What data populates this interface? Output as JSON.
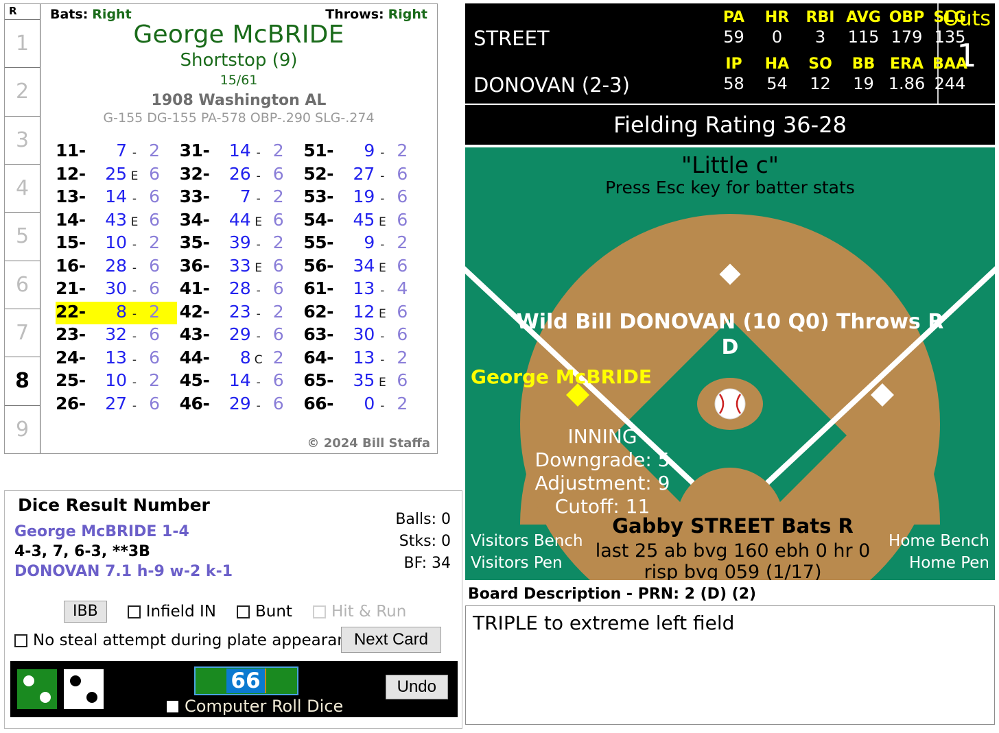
{
  "card": {
    "inning_header": "R",
    "innings": [
      "1",
      "2",
      "3",
      "4",
      "5",
      "6",
      "7",
      "8",
      "9"
    ],
    "current_inning": "8",
    "bats_label": "Bats:",
    "bats_value": "Right",
    "throws_label": "Throws:",
    "throws_value": "Right",
    "player_name": "George McBRIDE",
    "position": "Shortstop (9)",
    "ratings": "15/61",
    "team": "1908 Washington AL",
    "stats_line": "G-155 DG-155 PA-578 OBP-.290 SLG-.274",
    "copyright": "© 2024 Bill Staffa",
    "columns": [
      [
        {
          "roll": "11-",
          "num": "7",
          "flag": "-",
          "fld": "2",
          "highlight": false
        },
        {
          "roll": "12-",
          "num": "25",
          "flag": "E",
          "fld": "6",
          "highlight": false
        },
        {
          "roll": "13-",
          "num": "14",
          "flag": "-",
          "fld": "6",
          "highlight": false
        },
        {
          "roll": "14-",
          "num": "43",
          "flag": "E",
          "fld": "6",
          "highlight": false
        },
        {
          "roll": "15-",
          "num": "10",
          "flag": "-",
          "fld": "2",
          "highlight": false
        },
        {
          "roll": "16-",
          "num": "28",
          "flag": "-",
          "fld": "6",
          "highlight": false
        },
        {
          "roll": "21-",
          "num": "30",
          "flag": "-",
          "fld": "6",
          "highlight": false
        },
        {
          "roll": "22-",
          "num": "8",
          "flag": "-",
          "fld": "2",
          "highlight": true
        },
        {
          "roll": "23-",
          "num": "32",
          "flag": "-",
          "fld": "6",
          "highlight": false
        },
        {
          "roll": "24-",
          "num": "13",
          "flag": "-",
          "fld": "6",
          "highlight": false
        },
        {
          "roll": "25-",
          "num": "10",
          "flag": "-",
          "fld": "2",
          "highlight": false
        },
        {
          "roll": "26-",
          "num": "27",
          "flag": "-",
          "fld": "6",
          "highlight": false
        }
      ],
      [
        {
          "roll": "31-",
          "num": "14",
          "flag": "-",
          "fld": "2",
          "highlight": false
        },
        {
          "roll": "32-",
          "num": "26",
          "flag": "-",
          "fld": "6",
          "highlight": false
        },
        {
          "roll": "33-",
          "num": "7",
          "flag": "-",
          "fld": "2",
          "highlight": false
        },
        {
          "roll": "34-",
          "num": "44",
          "flag": "E",
          "fld": "6",
          "highlight": false
        },
        {
          "roll": "35-",
          "num": "39",
          "flag": "-",
          "fld": "2",
          "highlight": false
        },
        {
          "roll": "36-",
          "num": "33",
          "flag": "E",
          "fld": "6",
          "highlight": false
        },
        {
          "roll": "41-",
          "num": "28",
          "flag": "-",
          "fld": "6",
          "highlight": false
        },
        {
          "roll": "42-",
          "num": "23",
          "flag": "-",
          "fld": "2",
          "highlight": false
        },
        {
          "roll": "43-",
          "num": "29",
          "flag": "-",
          "fld": "6",
          "highlight": false
        },
        {
          "roll": "44-",
          "num": "8",
          "flag": "C",
          "fld": "2",
          "highlight": false
        },
        {
          "roll": "45-",
          "num": "14",
          "flag": "-",
          "fld": "6",
          "highlight": false
        },
        {
          "roll": "46-",
          "num": "29",
          "flag": "-",
          "fld": "6",
          "highlight": false
        }
      ],
      [
        {
          "roll": "51-",
          "num": "9",
          "flag": "-",
          "fld": "2",
          "highlight": false
        },
        {
          "roll": "52-",
          "num": "27",
          "flag": "-",
          "fld": "6",
          "highlight": false
        },
        {
          "roll": "53-",
          "num": "19",
          "flag": "-",
          "fld": "6",
          "highlight": false
        },
        {
          "roll": "54-",
          "num": "45",
          "flag": "E",
          "fld": "6",
          "highlight": false
        },
        {
          "roll": "55-",
          "num": "9",
          "flag": "-",
          "fld": "2",
          "highlight": false
        },
        {
          "roll": "56-",
          "num": "34",
          "flag": "E",
          "fld": "6",
          "highlight": false
        },
        {
          "roll": "61-",
          "num": "13",
          "flag": "-",
          "fld": "4",
          "highlight": false
        },
        {
          "roll": "62-",
          "num": "12",
          "flag": "E",
          "fld": "6",
          "highlight": false
        },
        {
          "roll": "63-",
          "num": "30",
          "flag": "-",
          "fld": "6",
          "highlight": false
        },
        {
          "roll": "64-",
          "num": "13",
          "flag": "-",
          "fld": "2",
          "highlight": false
        },
        {
          "roll": "65-",
          "num": "35",
          "flag": "E",
          "fld": "6",
          "highlight": false
        },
        {
          "roll": "66-",
          "num": "0",
          "flag": "-",
          "fld": "2",
          "highlight": false
        }
      ]
    ]
  },
  "dice_panel": {
    "title": "Dice Result Number",
    "batter_line": "George McBRIDE  1-4",
    "results_line": "4-3, 7, 6-3, **3B",
    "pitcher_line": "DONOVAN  7.1  h-9  w-2  k-1",
    "balls": "Balls: 0",
    "strikes": "Stks: 0",
    "bf": "BF: 34",
    "ibb_label": "IBB",
    "infield_in_label": "Infield IN",
    "bunt_label": "Bunt",
    "hit_and_run_label": "Hit & Run",
    "no_steal_label": "No steal attempt during plate appearance",
    "next_card_label": "Next Card",
    "computer_roll_label": "Computer Roll Dice",
    "undo_label": "Undo",
    "roll_value": "66",
    "die1_pips": "2",
    "die2_pips": "2"
  },
  "scoreboard": {
    "batter_name": "STREET",
    "batter_headers": [
      "PA",
      "HR",
      "RBI",
      "AVG",
      "OBP",
      "SLG"
    ],
    "batter_values": [
      "59",
      "0",
      "3",
      "115",
      "179",
      "135"
    ],
    "pitcher_name": "DONOVAN (2-3)",
    "pitcher_headers": [
      "IP",
      "HA",
      "SO",
      "BB",
      "ERA",
      "BAA"
    ],
    "pitcher_values": [
      "58",
      "54",
      "12",
      "19",
      "1.86",
      "244"
    ],
    "outs_label": "Outs",
    "outs_value": "1",
    "fielding_rating": "Fielding Rating 36-28"
  },
  "field": {
    "title": "\"Little c\"",
    "subtitle": "Press Esc key for batter stats",
    "pitcher_line": "Wild Bill DONOVAN (10 Q0) Throws R",
    "pitcher_sub": "D",
    "runner_third": "George McBRIDE",
    "inning_label": "INNING",
    "downgrade": "Downgrade: 5",
    "adjustment": "Adjustment: 9",
    "cutoff": "Cutoff: 11",
    "batter_line": "Gabby STREET Bats R",
    "batter_sub1": "last 25 ab bvg 160 ebh 0 hr 0",
    "batter_sub2": "risp bvg 059 (1/17)",
    "visitors_bench": "Visitors Bench",
    "visitors_pen": "Visitors Pen",
    "home_bench": "Home Bench",
    "home_pen": "Home Pen"
  },
  "board": {
    "title": "Board Description - PRN: 2 (D) (2)",
    "description": "TRIPLE to extreme left field"
  },
  "colors": {
    "grass": "#0e8a64",
    "dirt": "#b98a4e",
    "highlight": "#ffff00",
    "accent_blue": "#2222ee",
    "scoreboard_bg": "#000000",
    "header_yellow": "#ffff00"
  }
}
